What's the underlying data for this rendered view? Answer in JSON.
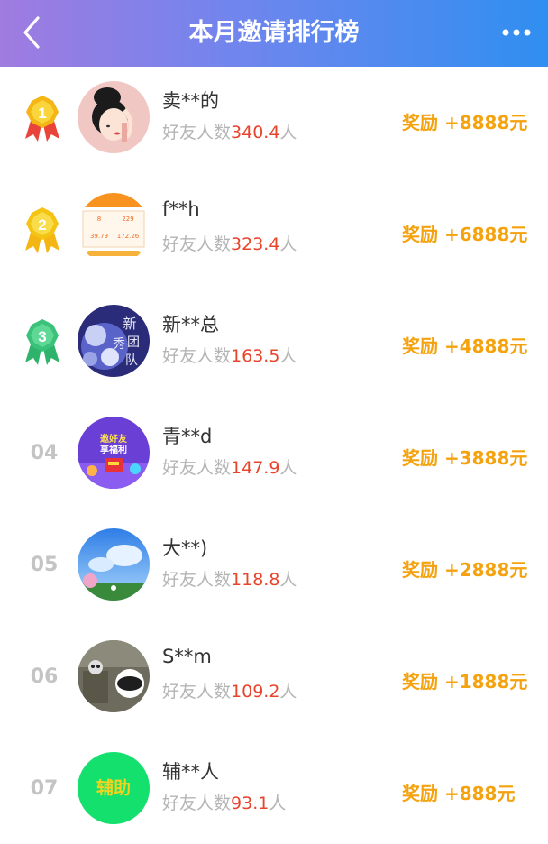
{
  "header": {
    "title": "本月邀请排行榜",
    "back_icon": "chevron-left-icon",
    "more_icon": "more-dots-icon",
    "gradient": [
      "#a07be0",
      "#2f8ff0"
    ]
  },
  "colors": {
    "reward": "#f5a20f",
    "friend_count": "#e8442c",
    "rank_number": "#c4c4c4",
    "medal_gold": "#f4b614",
    "medal_green": "#3ac27a"
  },
  "ranking": [
    {
      "rank": "1",
      "medal": "gold-medal-icon",
      "name": "卖**的",
      "friends_label": "好友人数",
      "friends_count": "340.4",
      "friends_unit": "人",
      "reward": "奖励 +8888元"
    },
    {
      "rank": "2",
      "medal": "gold-medal-icon",
      "name": "f**h",
      "friends_label": "好友人数",
      "friends_count": "323.4",
      "friends_unit": "人",
      "reward": "奖励 +6888元"
    },
    {
      "rank": "3",
      "medal": "green-medal-icon",
      "name": "新**总",
      "friends_label": "好友人数",
      "friends_count": "163.5",
      "friends_unit": "人",
      "reward": "奖励 +4888元"
    },
    {
      "rank": "04",
      "name": "青**d",
      "friends_label": "好友人数",
      "friends_count": "147.9",
      "friends_unit": "人",
      "reward": "奖励 +3888元"
    },
    {
      "rank": "05",
      "name": "大**)",
      "friends_label": "好友人数",
      "friends_count": "118.8",
      "friends_unit": "人",
      "reward": "奖励 +2888元"
    },
    {
      "rank": "06",
      "name": "S**m",
      "friends_label": "好友人数",
      "friends_count": "109.2",
      "friends_unit": "人",
      "reward": "奖励 +1888元"
    },
    {
      "rank": "07",
      "name": "辅**人",
      "friends_label": "好友人数",
      "friends_count": "93.1",
      "friends_unit": "人",
      "reward": "奖励 +888元",
      "avatar_text": "辅助"
    }
  ],
  "avatar_texts": {
    "row2": {
      "a": "8",
      "b": "229",
      "c": "39.79",
      "d": "172.26"
    },
    "row3": {
      "title": "新",
      "b": "秀",
      "c": "团",
      "d": "队"
    },
    "row4": {
      "a": "邀好友",
      "b": "享福利"
    }
  }
}
